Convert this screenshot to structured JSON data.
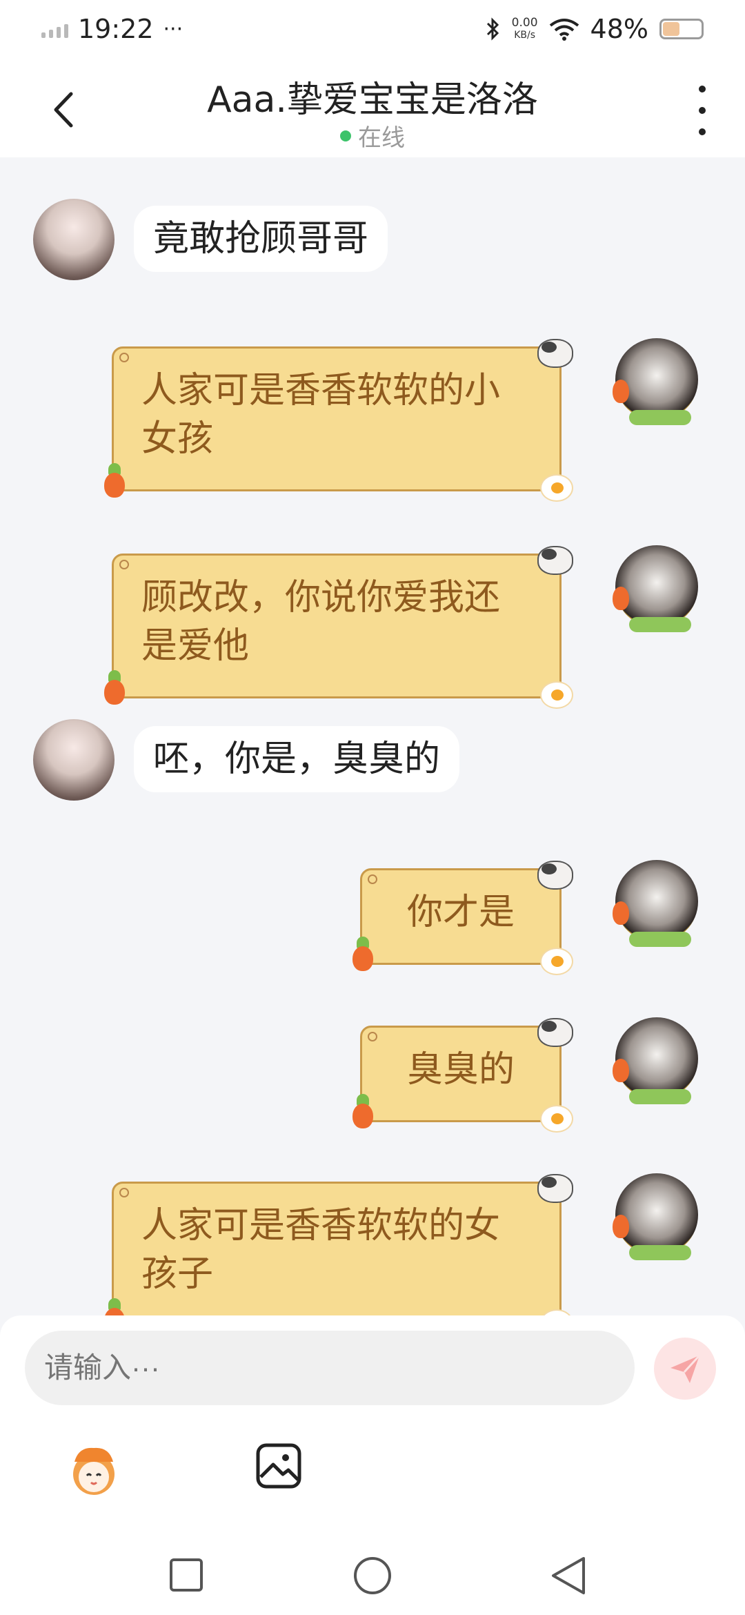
{
  "status_bar": {
    "time": "19:22",
    "more": "···",
    "net_speed_value": "0.00",
    "net_speed_unit": "KB/s",
    "battery": "48%",
    "battery_level": 0.48
  },
  "header": {
    "title": "Aaa.挚爱宝宝是洛洛",
    "status": "在线",
    "status_color": "#3cc36a"
  },
  "messages": [
    {
      "side": "left",
      "text": "竟敢抢顾哥哥"
    },
    {
      "side": "right",
      "text": "人家可是香香软软的小女孩"
    },
    {
      "side": "right",
      "text": "顾改改，你说你爱我还是爱他"
    },
    {
      "side": "left",
      "text": "呸，你是，臭臭的"
    },
    {
      "side": "right",
      "text": "你才是"
    },
    {
      "side": "right",
      "text": "臭臭的"
    },
    {
      "side": "right",
      "text": "人家可是香香软软的女孩子"
    }
  ],
  "composer": {
    "placeholder": "请输入···",
    "send_icon": "send-icon"
  },
  "colors": {
    "bubble_yellow": "#f7dc92",
    "bubble_text": "#8e5a1e",
    "background": "#f4f5f8"
  }
}
